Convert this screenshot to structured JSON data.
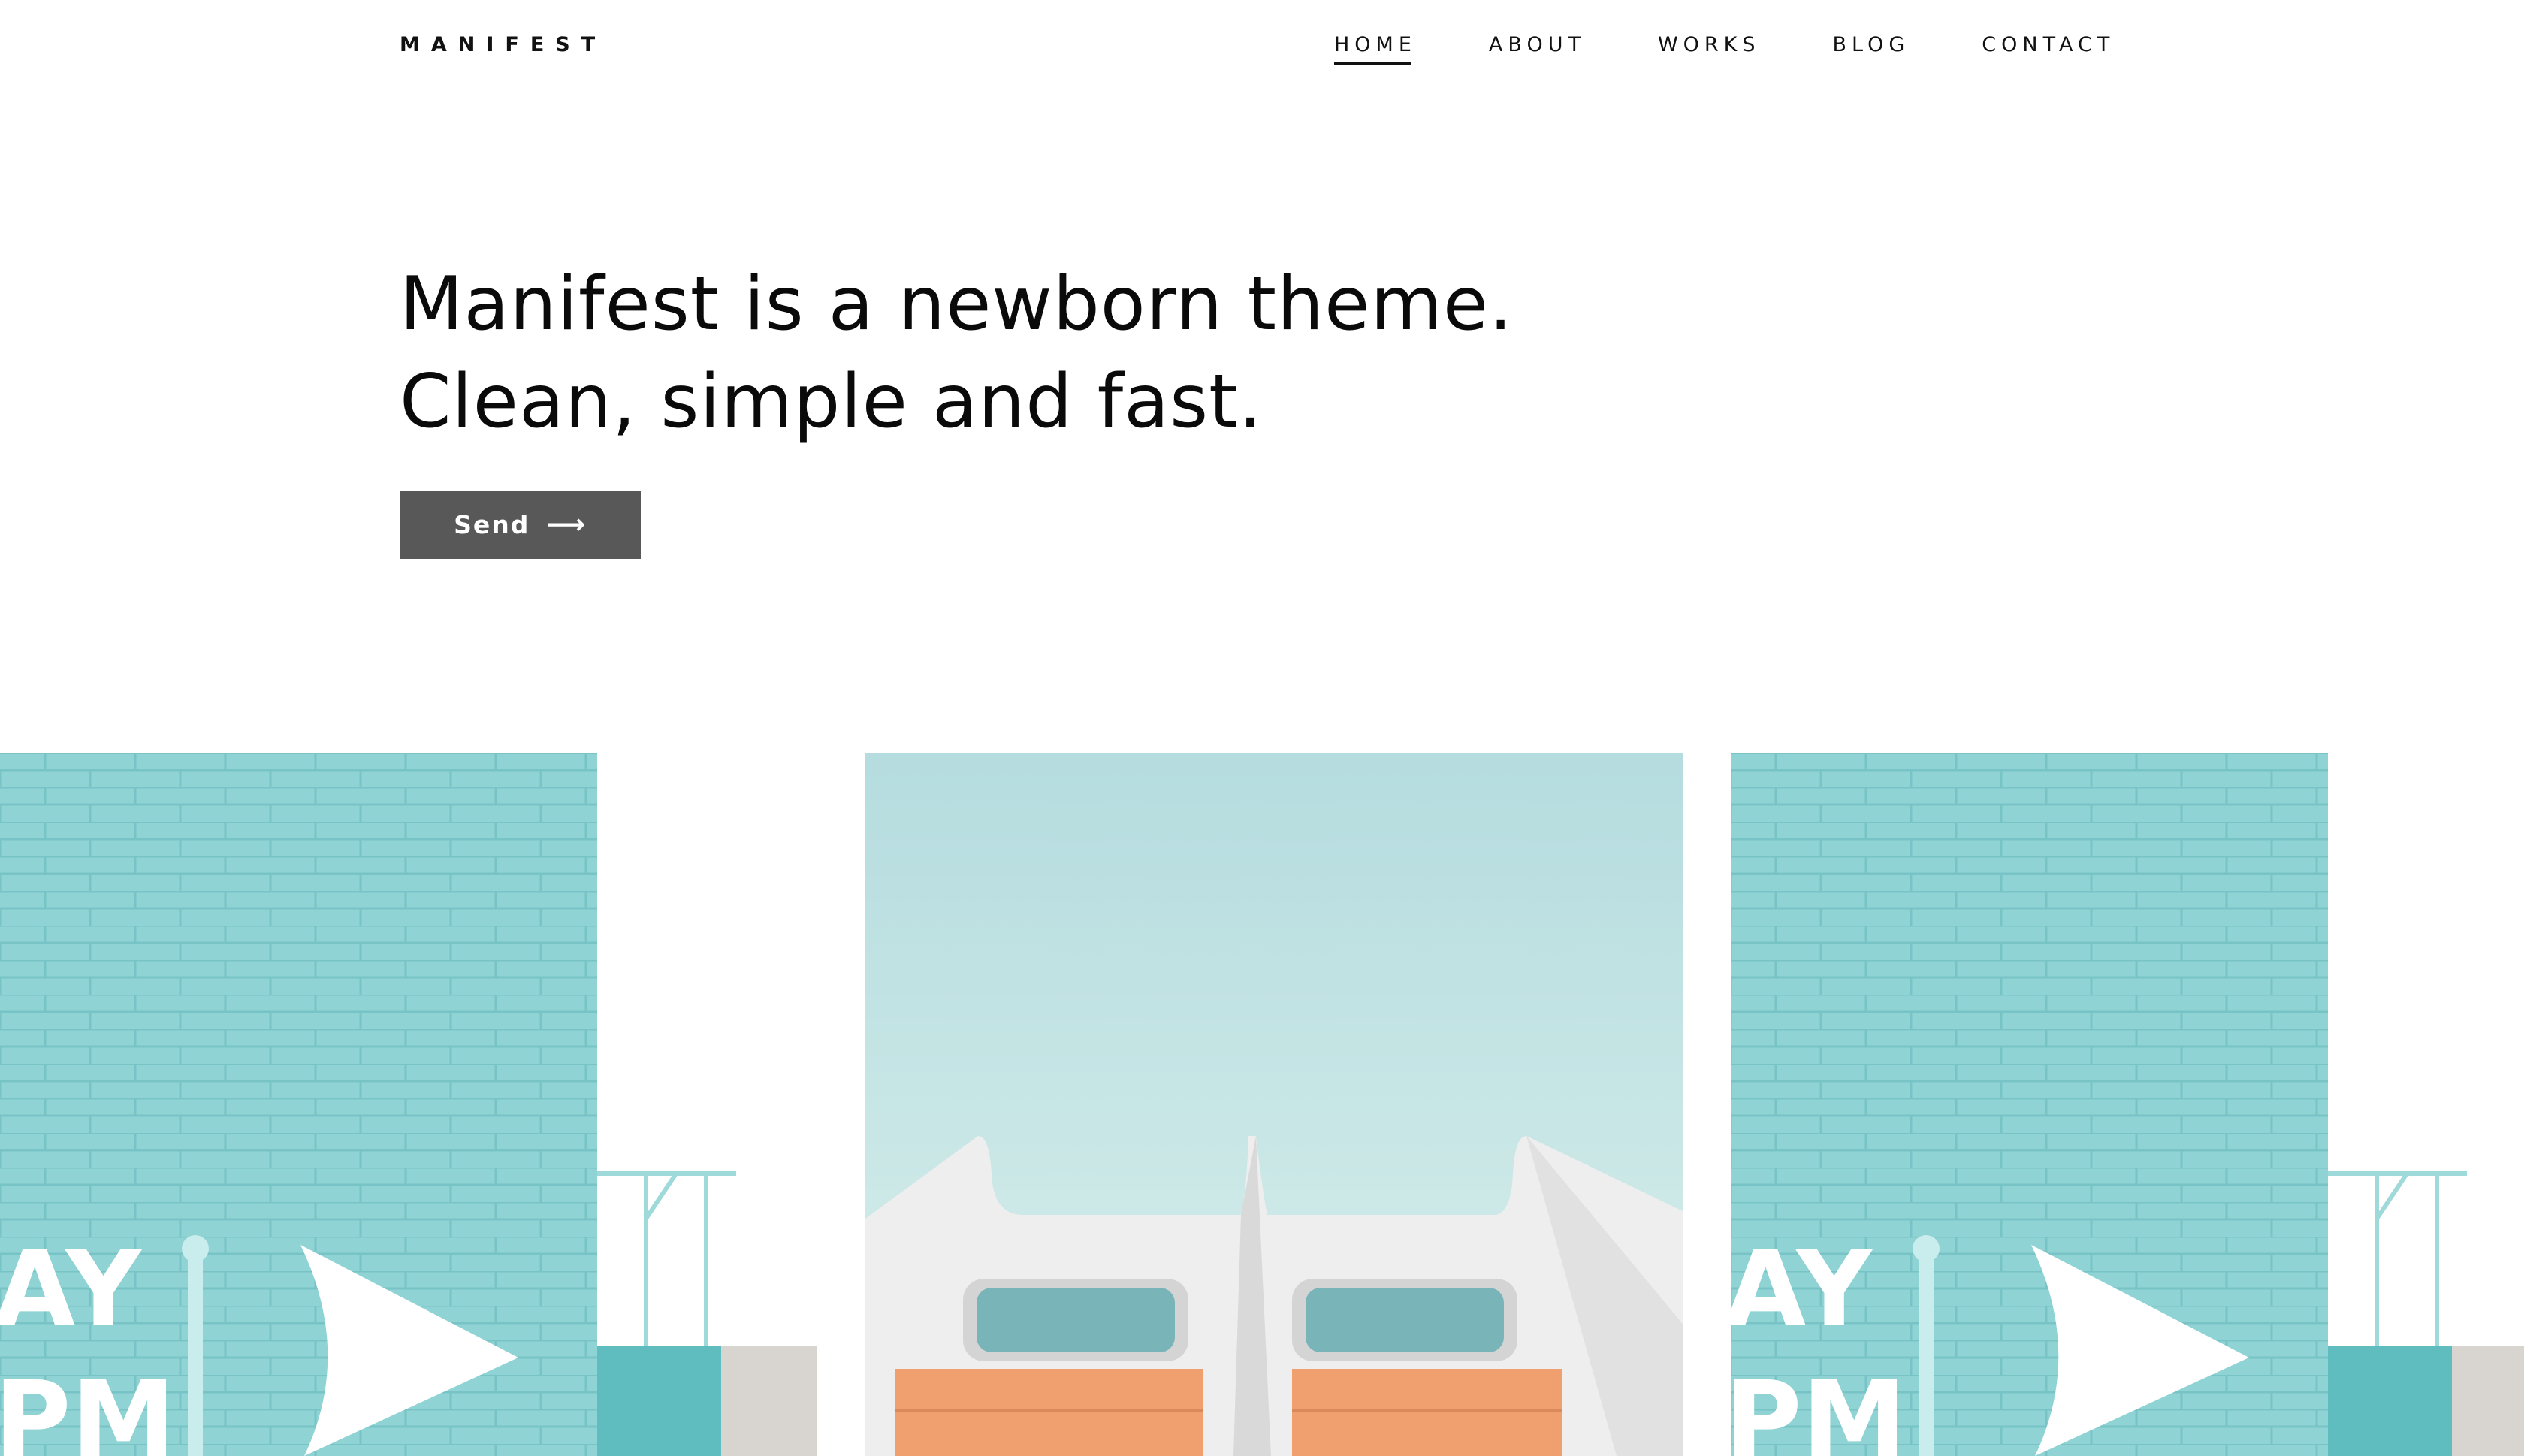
{
  "brand": {
    "logo": "MANIFEST"
  },
  "nav": {
    "items": [
      {
        "label": "HOME",
        "active": true
      },
      {
        "label": "ABOUT",
        "active": false
      },
      {
        "label": "WORKS",
        "active": false
      },
      {
        "label": "BLOG",
        "active": false
      },
      {
        "label": "CONTACT",
        "active": false
      }
    ]
  },
  "hero": {
    "line1": "Manifest is a newborn theme.",
    "line2": "Clean, simple and fast.",
    "button_label": "Send",
    "button_icon": "arrow-right-icon"
  },
  "gallery": {
    "images": [
      {
        "name": "turquoise-brick-wall-photo",
        "wall_text_line1": "AY",
        "wall_text_line2": "PM"
      },
      {
        "name": "white-building-orange-panels-photo"
      },
      {
        "name": "turquoise-brick-wall-photo-repeat",
        "wall_text_line1": "AY",
        "wall_text_line2": "PM"
      }
    ]
  },
  "colors": {
    "button": "#585858",
    "text": "#111111",
    "wall_turquoise": "#8fd3d4",
    "sky": "#b9dde0",
    "orange_panel": "#f0a06f"
  }
}
